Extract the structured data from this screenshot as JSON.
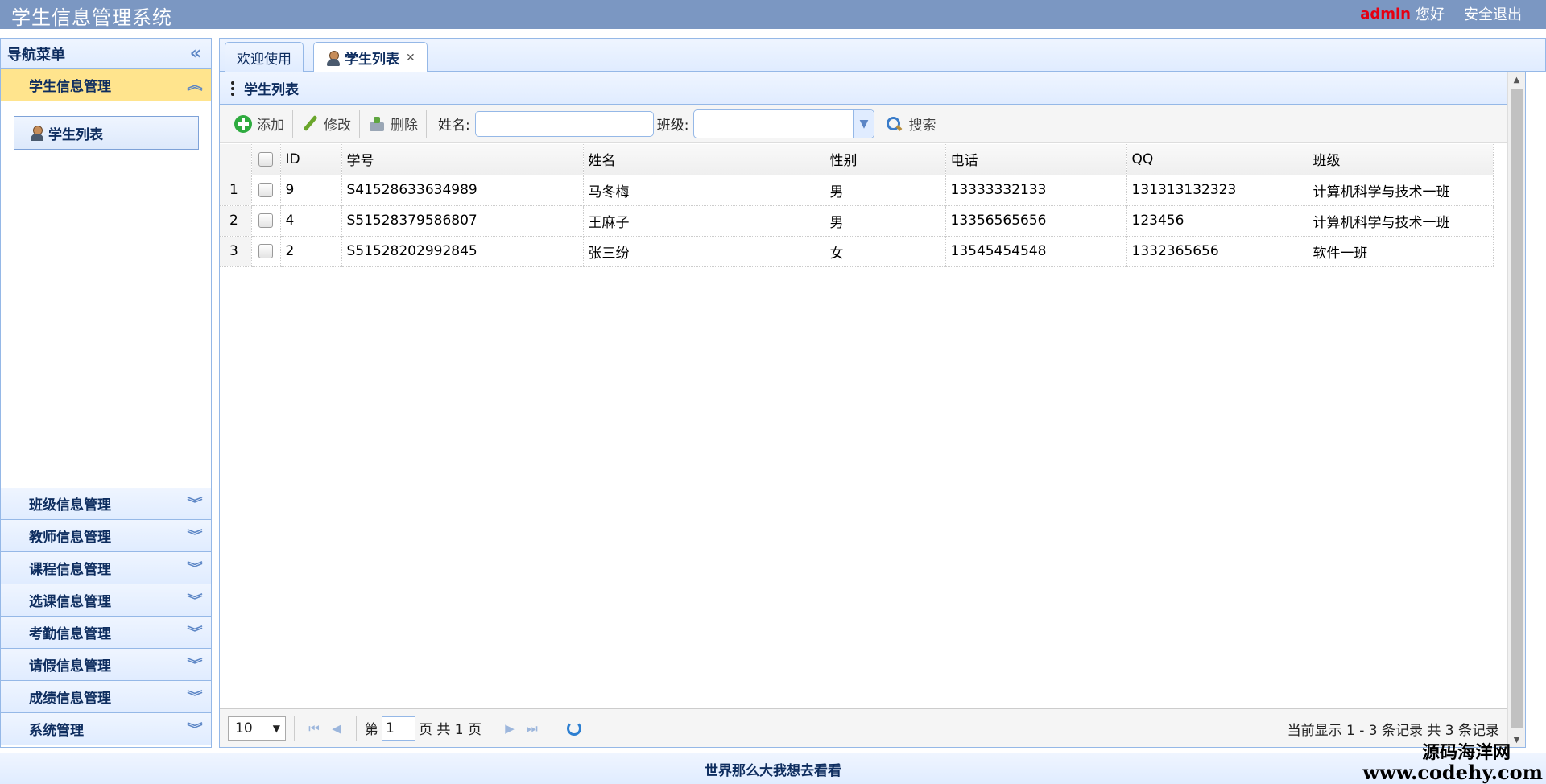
{
  "header": {
    "title": "学生信息管理系统",
    "user": "admin",
    "greeting": "您好",
    "logout": "安全退出"
  },
  "sidebar": {
    "title": "导航菜单",
    "active_section": "学生信息管理",
    "active_item": "学生列表",
    "sections": [
      "班级信息管理",
      "教师信息管理",
      "课程信息管理",
      "选课信息管理",
      "考勤信息管理",
      "请假信息管理",
      "成绩信息管理",
      "系统管理"
    ]
  },
  "tabs": [
    {
      "label": "欢迎使用"
    },
    {
      "label": "学生列表"
    }
  ],
  "panel": {
    "title": "学生列表"
  },
  "toolbar": {
    "add": "添加",
    "edit": "修改",
    "delete": "删除",
    "name_label": "姓名:",
    "class_label": "班级:",
    "name_value": "",
    "class_value": "",
    "search": "搜索"
  },
  "table": {
    "columns": [
      "ID",
      "学号",
      "姓名",
      "性别",
      "电话",
      "QQ",
      "班级"
    ],
    "rows": [
      {
        "num": "1",
        "id": "9",
        "sn": "S41528633634989",
        "name": "马冬梅",
        "gender": "男",
        "phone": "13333332133",
        "qq": "131313132323",
        "class": "计算机科学与技术一班"
      },
      {
        "num": "2",
        "id": "4",
        "sn": "S51528379586807",
        "name": "王麻子",
        "gender": "男",
        "phone": "13356565656",
        "qq": "123456",
        "class": "计算机科学与技术一班"
      },
      {
        "num": "3",
        "id": "2",
        "sn": "S51528202992845",
        "name": "张三纷",
        "gender": "女",
        "phone": "13545454548",
        "qq": "1332365656",
        "class": "软件一班"
      }
    ]
  },
  "pager": {
    "page_size": "10",
    "page_prefix": "第",
    "page": "1",
    "page_mid": "页 共 1 页",
    "info": "当前显示 1 - 3 条记录 共 3 条记录"
  },
  "footer": {
    "text": "世界那么大我想去看看"
  },
  "watermark": {
    "cn": "源码海洋网",
    "url": "www.codehy.com"
  }
}
